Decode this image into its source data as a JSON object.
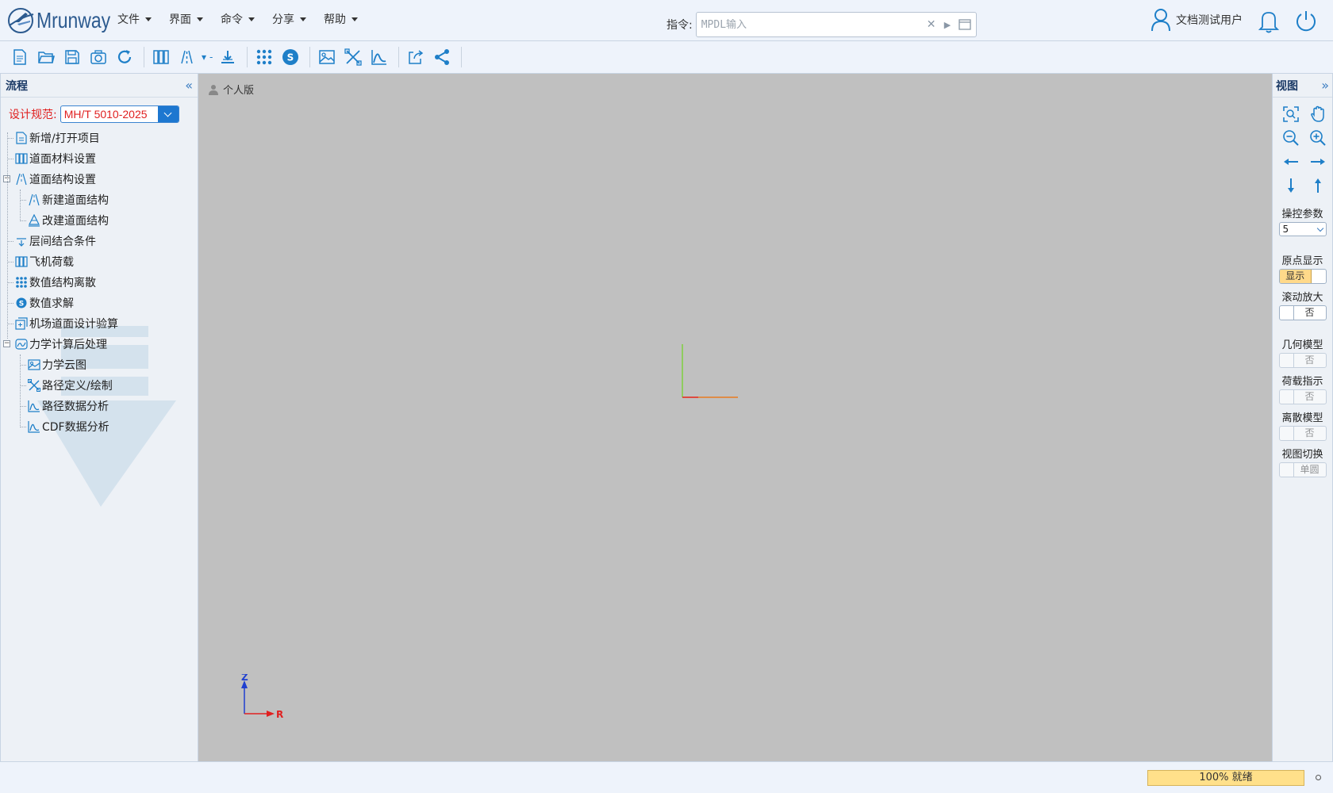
{
  "app": {
    "brand": "Mrunway",
    "menus": [
      "文件",
      "界面",
      "命令",
      "分享",
      "帮助"
    ]
  },
  "command": {
    "label": "指令:",
    "placeholder": "MPDL输入"
  },
  "user": {
    "name": "文档测试用户"
  },
  "left_panel": {
    "title": "流程",
    "spec_label": "设计规范:",
    "spec_value": "MH/T 5010-2025",
    "tree": [
      {
        "label": "新增/打开项目",
        "icon": "document-icon"
      },
      {
        "label": "道面材料设置",
        "icon": "material-columns-icon"
      },
      {
        "label": "道面结构设置",
        "icon": "structure-icon",
        "expanded": true
      },
      {
        "label": "新建道面结构",
        "icon": "structure-icon",
        "child": true
      },
      {
        "label": "改建道面结构",
        "icon": "layers-icon",
        "child": true
      },
      {
        "label": "层间结合条件",
        "icon": "interface-icon"
      },
      {
        "label": "飞机荷载",
        "icon": "aircraft-load-icon"
      },
      {
        "label": "数值结构离散",
        "icon": "mesh-grid-icon"
      },
      {
        "label": "数值求解",
        "icon": "solver-icon"
      },
      {
        "label": "机场道面设计验算",
        "icon": "check-icon"
      },
      {
        "label": "力学计算后处理",
        "icon": "postprocess-icon",
        "expanded": true
      },
      {
        "label": "力学云图",
        "icon": "image-icon",
        "child": true
      },
      {
        "label": "路径定义/绘制",
        "icon": "path-icon",
        "child": true
      },
      {
        "label": "路径数据分析",
        "icon": "chart-icon",
        "child": true
      },
      {
        "label": "CDF数据分析",
        "icon": "chart-icon",
        "child": true
      }
    ]
  },
  "canvas": {
    "edition": "个人版",
    "axis_z": "Z",
    "axis_r": "R"
  },
  "right_panel": {
    "title": "视图",
    "control_param_label": "操控参数",
    "control_param_value": "5",
    "origin_label": "原点显示",
    "origin_value": "显示",
    "scroll_zoom_label": "滚动放大",
    "scroll_zoom_value": "否",
    "geometry_label": "几何模型",
    "geometry_value": "否",
    "load_label": "荷载指示",
    "load_value": "否",
    "discrete_label": "离散模型",
    "discrete_value": "否",
    "view_switch_label": "视图切换",
    "view_switch_value": "单圆"
  },
  "status": {
    "progress_text": "100% 就绪",
    "progress": 1.0
  },
  "colors": {
    "accent": "#1e7fc8",
    "spec_text": "#e02020",
    "canvas_bg": "#c0c0c0",
    "progress": "#ffe08a"
  }
}
